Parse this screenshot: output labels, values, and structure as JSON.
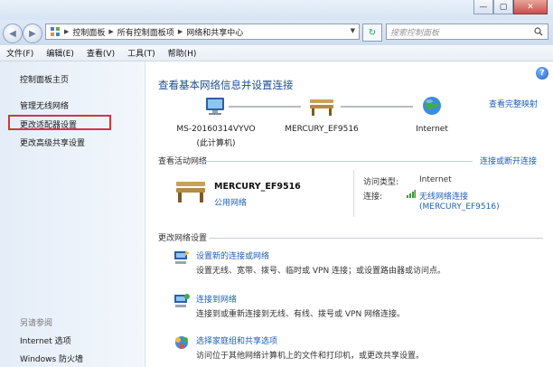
{
  "window": {
    "min_symbol": "—",
    "max_symbol": "▢",
    "close_symbol": "✕"
  },
  "breadcrumb": [
    "控制面板",
    "所有控制面板项",
    "网络和共享中心"
  ],
  "search": {
    "placeholder": "搜索控制面板"
  },
  "menu": [
    "文件(F)",
    "编辑(E)",
    "查看(V)",
    "工具(T)",
    "帮助(H)"
  ],
  "sidebar": {
    "items": [
      "控制面板主页",
      "管理无线网络",
      "更改适配器设置",
      "更改高级共享设置"
    ],
    "see_also_title": "另请参阅",
    "see_also": [
      "Internet 选项",
      "Windows 防火墙"
    ]
  },
  "main": {
    "title": "查看基本网络信息并设置连接",
    "full_map": "查看完整映射",
    "map": {
      "computer_name": "MS-20160314VYVO",
      "computer_sub": "(此计算机)",
      "network_name": "MERCURY_EF9516",
      "internet": "Internet"
    },
    "active": {
      "title": "查看活动网络",
      "connect_link": "连接或断开连接",
      "network_name": "MERCURY_EF9516",
      "network_type": "公用网络",
      "access_label": "访问类型:",
      "access_value": "Internet",
      "conn_label": "连接:",
      "conn_value": "无线网络连接",
      "conn_value2": "(MERCURY_EF9516)"
    },
    "settings": {
      "title": "更改网络设置",
      "tasks": [
        {
          "link": "设置新的连接或网络",
          "desc": "设置无线、宽带、拨号、临时或 VPN 连接；或设置路由器或访问点。"
        },
        {
          "link": "连接到网络",
          "desc": "连接到或重新连接到无线、有线、拨号或 VPN 网络连接。"
        },
        {
          "link": "选择家庭组和共享选项",
          "desc": "访问位于其他网络计算机上的文件和打印机，或更改共享设置。"
        }
      ]
    }
  }
}
